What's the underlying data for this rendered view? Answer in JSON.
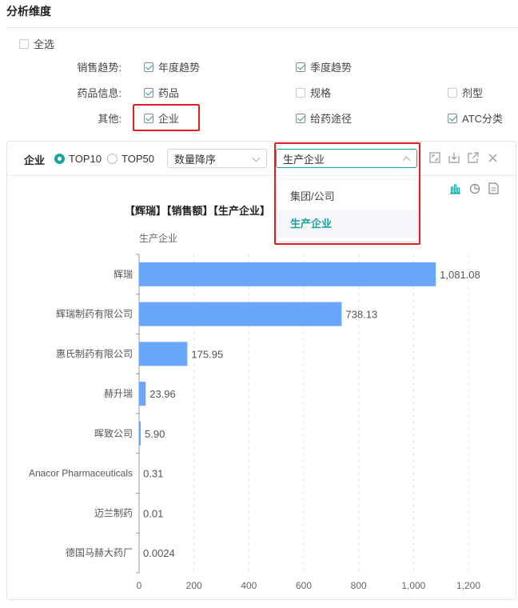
{
  "section": {
    "title": "分析维度"
  },
  "select_all": {
    "label": "全选",
    "checked": false
  },
  "rows": [
    {
      "label": "销售趋势:",
      "options": [
        {
          "label": "年度趋势",
          "checked": true
        },
        {
          "label": "季度趋势",
          "checked": true
        }
      ]
    },
    {
      "label": "药品信息:",
      "options": [
        {
          "label": "药品",
          "checked": true
        },
        {
          "label": "规格",
          "checked": false
        },
        {
          "label": "剂型",
          "checked": false
        }
      ]
    },
    {
      "label": "其他:",
      "options": [
        {
          "label": "企业",
          "checked": true
        },
        {
          "label": "给药途径",
          "checked": true
        },
        {
          "label": "ATC分类",
          "checked": true
        }
      ]
    }
  ],
  "panel": {
    "title": "企业",
    "radios": [
      {
        "label": "TOP10",
        "selected": true
      },
      {
        "label": "TOP50",
        "selected": false
      }
    ],
    "sort_select": {
      "value": "数量降序"
    },
    "level_select": {
      "value": "生产企业",
      "options": [
        "集团/公司",
        "生产企业"
      ],
      "selected_index": 1
    },
    "toolbar_icons": [
      "fullscreen-icon",
      "download-icon",
      "external-link-icon",
      "close-icon"
    ],
    "view_icons": [
      "bar-chart-icon",
      "pie-chart-icon",
      "table-icon"
    ]
  },
  "accent_color": "#1aa39a",
  "highlight_color": "#e02020",
  "chart_data": {
    "type": "bar",
    "orientation": "horizontal",
    "title": "【辉瑞】【销售额】【生产企业】",
    "ylabel": "生产企业",
    "categories": [
      "辉瑞",
      "辉瑞制药有限公司",
      "惠氏制药有限公司",
      "赫升瑞",
      "晖致公司",
      "Anacor Pharmaceuticals",
      "迈兰制药",
      "德国马赫大药厂"
    ],
    "values": [
      1081.08,
      738.13,
      175.95,
      23.96,
      5.9,
      0.31,
      0.01,
      0.0024
    ],
    "value_labels": [
      "1,081.08",
      "738.13",
      "175.95",
      "23.96",
      "5.90",
      "0.31",
      "0.01",
      "0.0024"
    ],
    "xlim": [
      0,
      1200
    ],
    "xticks": [
      "0",
      "200",
      "400",
      "600",
      "800",
      "1,000",
      "1,200"
    ],
    "bar_color": "#6aa6fb",
    "grid": "vertical-dashed"
  }
}
